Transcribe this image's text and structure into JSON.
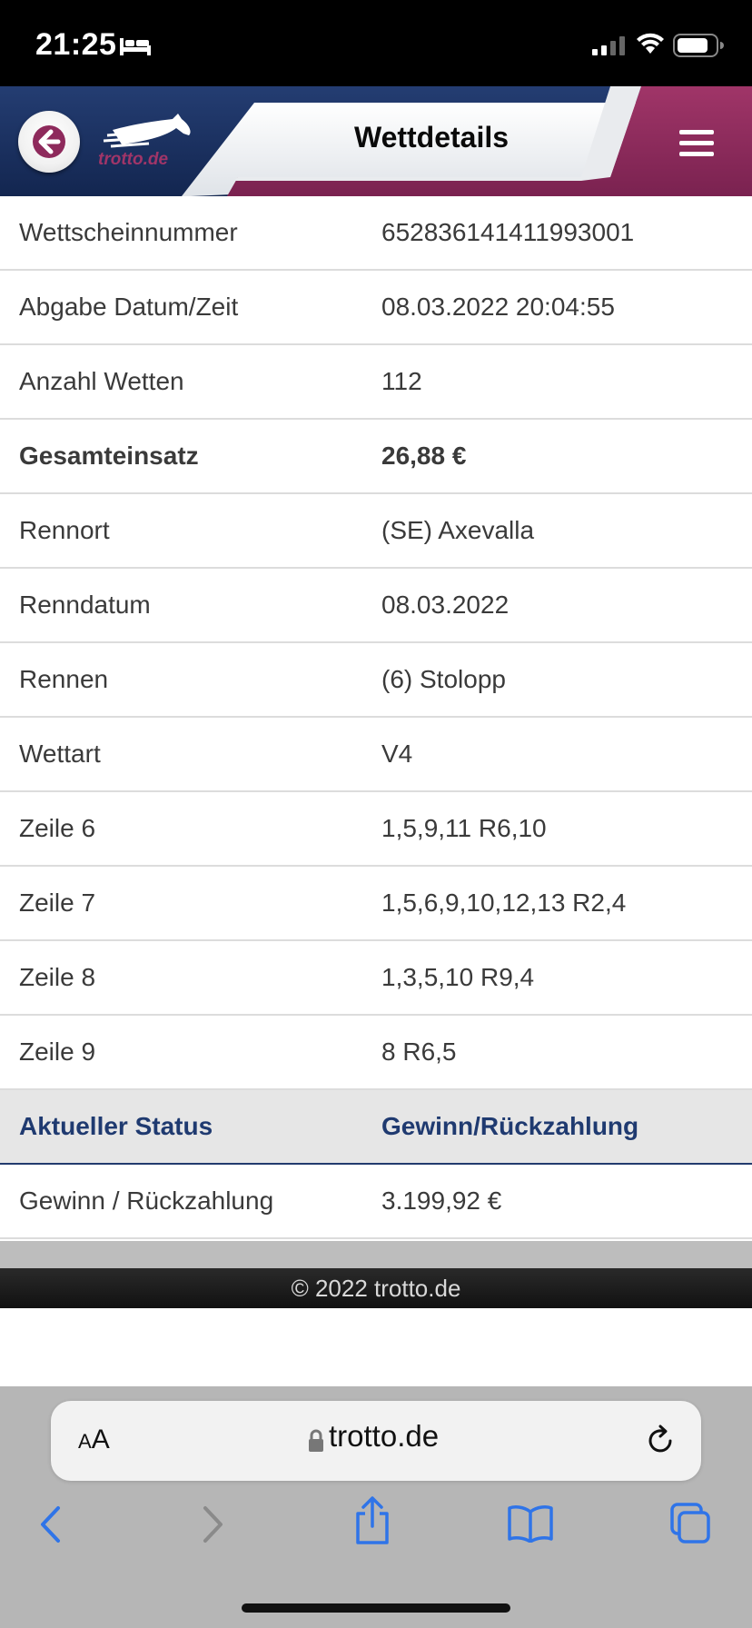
{
  "status_bar": {
    "time": "21:25",
    "icons": [
      "bed-icon",
      "signal-icon",
      "wifi-icon",
      "battery-icon"
    ]
  },
  "header": {
    "title": "Wettdetails",
    "logo_text": "trotto.de",
    "back_icon": "arrow-left-icon",
    "menu_icon": "hamburger-menu-icon"
  },
  "details": {
    "rows": [
      {
        "label": "Wettscheinnummer",
        "value": "652836141411993001"
      },
      {
        "label": "Abgabe Datum/Zeit",
        "value": "08.03.2022 20:04:55"
      },
      {
        "label": "Anzahl Wetten",
        "value": "112"
      },
      {
        "label": "Gesamteinsatz",
        "value": "26,88 €"
      },
      {
        "label": "Rennort",
        "value": "(SE) Axevalla"
      },
      {
        "label": "Renndatum",
        "value": "08.03.2022"
      },
      {
        "label": "Rennen",
        "value": "(6) Stolopp"
      },
      {
        "label": "Wettart",
        "value": "V4"
      },
      {
        "label": "Zeile 6",
        "value": "1,5,9,11 R6,10"
      },
      {
        "label": "Zeile 7",
        "value": "1,5,6,9,10,12,13 R2,4"
      },
      {
        "label": "Zeile 8",
        "value": "1,3,5,10 R9,4"
      },
      {
        "label": "Zeile 9",
        "value": "8 R6,5"
      }
    ],
    "status": {
      "label": "Aktueller Status",
      "value": "Gewinn/Rückzahlung"
    },
    "payout": {
      "label": "Gewinn / Rückzahlung",
      "value": "3.199,92 €"
    }
  },
  "footer": {
    "text": "© 2022 trotto.de"
  },
  "browser": {
    "text_size_label_small": "A",
    "text_size_label_large": "A",
    "url": "trotto.de",
    "toolbar_icons": [
      "back-icon",
      "forward-icon",
      "share-icon",
      "bookmarks-icon",
      "tabs-icon"
    ]
  },
  "colors": {
    "brand_navy": "#1a2e5c",
    "brand_magenta": "#8e2a5c",
    "status_text": "#1f3a70",
    "safari_blue": "#2f74e8"
  }
}
